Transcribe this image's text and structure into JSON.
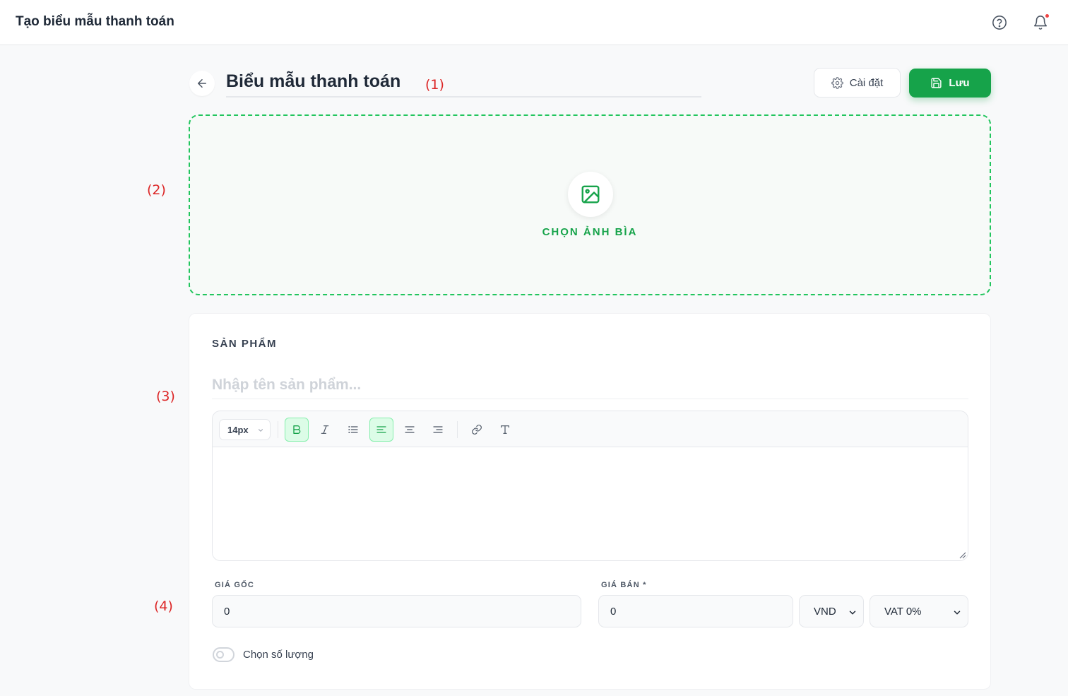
{
  "topbar": {
    "title": "Tạo biểu mẫu thanh toán",
    "icons": [
      "help-icon",
      "bell-icon"
    ],
    "notification_dot_color": "#ef4444"
  },
  "header": {
    "form_title": "Biểu mẫu thanh toán",
    "settings_label": "Cài đặt",
    "save_label": "Lưu"
  },
  "annotations": {
    "a1": "(1)",
    "a2": "(2)",
    "a3": "(3)",
    "a4": "(4)"
  },
  "cover": {
    "label": "CHỌN ẢNH BÌA"
  },
  "product": {
    "heading": "SẢN PHẨM",
    "name_placeholder": "Nhập tên sản phẩm...",
    "name_value": "",
    "editor": {
      "font_size": "14px",
      "tools": [
        "bold",
        "italic",
        "bullet-list",
        "align-left",
        "align-center",
        "align-right",
        "link",
        "clear-format"
      ],
      "active_tools": [
        "bold",
        "align-left"
      ],
      "content": ""
    },
    "original_price": {
      "label": "GIÁ GỐC",
      "value": "0"
    },
    "sale_price": {
      "label": "GIÁ BÁN *",
      "value": "0"
    },
    "currency": {
      "selected": "VND"
    },
    "vat": {
      "selected": "VAT 0%"
    },
    "quantity_toggle": {
      "label": "Chọn số lượng",
      "enabled": false
    }
  },
  "colors": {
    "accent": "#16a34a",
    "dropzone_border": "#22c55e",
    "annotation": "#dc2626",
    "active_tool_bg": "#dcfce7"
  }
}
